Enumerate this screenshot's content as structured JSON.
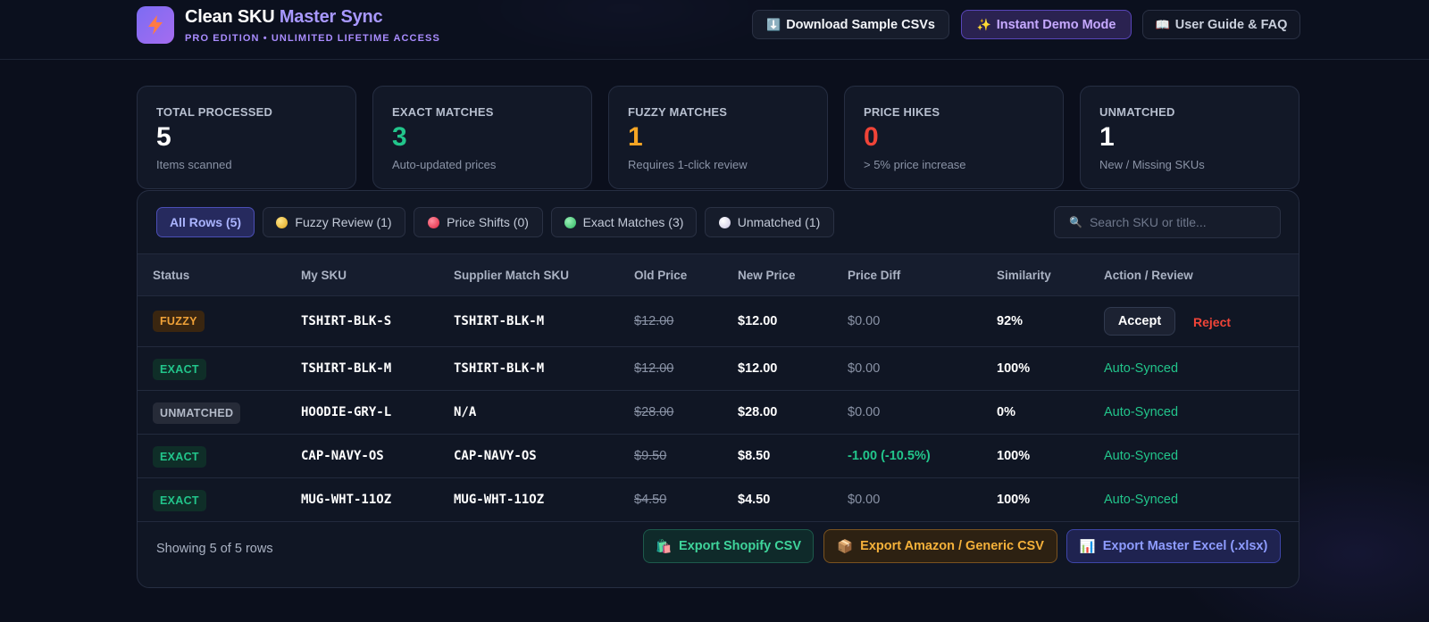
{
  "header": {
    "title_main": "Clean SKU",
    "title_accent": "Master Sync",
    "subtitle": "PRO EDITION • UNLIMITED LIFETIME ACCESS",
    "logo_icon": "lightning-bolt-icon",
    "buttons": {
      "download": {
        "icon": "⬇️",
        "label": "Download Sample CSVs"
      },
      "demo": {
        "icon": "✨",
        "label": "Instant Demo Mode"
      },
      "guide": {
        "icon": "📖",
        "label": "User Guide & FAQ"
      }
    }
  },
  "stats": [
    {
      "label": "TOTAL PROCESSED",
      "value": "5",
      "note": "Items scanned",
      "color": "#ffffff"
    },
    {
      "label": "EXACT MATCHES",
      "value": "3",
      "note": "Auto-updated prices",
      "color": "#22c58b"
    },
    {
      "label": "FUZZY MATCHES",
      "value": "1",
      "note": "Requires 1-click review",
      "color": "#f5a524"
    },
    {
      "label": "PRICE HIKES",
      "value": "0",
      "note": "> 5% price increase",
      "color": "#f04438"
    },
    {
      "label": "UNMATCHED",
      "value": "1",
      "note": "New / Missing SKUs",
      "color": "#ffffff"
    }
  ],
  "filters": {
    "all": "All Rows (5)",
    "fuzzy": "Fuzzy Review (1)",
    "price": "Price Shifts (0)",
    "exact": "Exact Matches (3)",
    "unmatched": "Unmatched (1)"
  },
  "search": {
    "icon": "🔍",
    "placeholder": "Search SKU or title..."
  },
  "table": {
    "headers": [
      "Status",
      "My SKU",
      "Supplier Match SKU",
      "Old Price",
      "New Price",
      "Price Diff",
      "Similarity",
      "Action / Review"
    ],
    "rows": [
      {
        "status": "FUZZY",
        "my_sku": "TSHIRT-BLK-S",
        "supplier_sku": "TSHIRT-BLK-M",
        "old_price": "$12.00",
        "new_price": "$12.00",
        "price_diff": "$0.00",
        "similarity": "92%",
        "action_accept": "Accept",
        "action_reject": "Reject"
      },
      {
        "status": "EXACT",
        "my_sku": "TSHIRT-BLK-M",
        "supplier_sku": "TSHIRT-BLK-M",
        "old_price": "$12.00",
        "new_price": "$12.00",
        "price_diff": "$0.00",
        "similarity": "100%",
        "action": "Auto-Synced"
      },
      {
        "status": "UNMATCHED",
        "my_sku": "HOODIE-GRY-L",
        "supplier_sku": "N/A",
        "old_price": "$28.00",
        "new_price": "$28.00",
        "price_diff": "$0.00",
        "similarity": "0%",
        "action": "Auto-Synced"
      },
      {
        "status": "EXACT",
        "my_sku": "CAP-NAVY-OS",
        "supplier_sku": "CAP-NAVY-OS",
        "old_price": "$9.50",
        "new_price": "$8.50",
        "price_diff": "-1.00 (-10.5%)",
        "similarity": "100%",
        "action": "Auto-Synced"
      },
      {
        "status": "EXACT",
        "my_sku": "MUG-WHT-11OZ",
        "supplier_sku": "MUG-WHT-11OZ",
        "old_price": "$4.50",
        "new_price": "$4.50",
        "price_diff": "$0.00",
        "similarity": "100%",
        "action": "Auto-Synced"
      }
    ]
  },
  "footer": {
    "showing": "Showing 5 of 5 rows",
    "export_shopify": {
      "icon": "🛍️",
      "label": "Export Shopify CSV"
    },
    "export_amazon": {
      "icon": "📦",
      "label": "Export Amazon / Generic CSV"
    },
    "export_excel": {
      "icon": "📊",
      "label": "Export Master Excel (.xlsx)"
    }
  }
}
